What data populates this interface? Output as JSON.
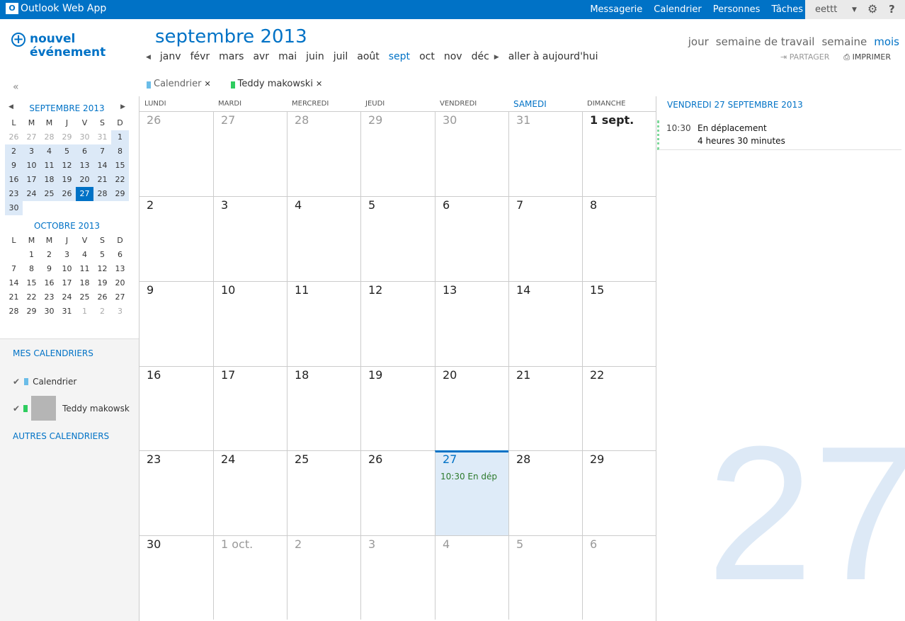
{
  "app": {
    "title": "Outlook Web App",
    "logo_text": "O"
  },
  "nav": [
    "Messagerie",
    "Calendrier",
    "Personnes",
    "Tâches"
  ],
  "user": {
    "name": "eettt",
    "settings_icon": "gear-icon",
    "help_icon": "?"
  },
  "new_event": {
    "line1": "nouvel",
    "line2": "événement"
  },
  "header": {
    "title": "septembre 2013",
    "months": [
      "janv",
      "févr",
      "mars",
      "avr",
      "mai",
      "juin",
      "juil",
      "août",
      "sept",
      "oct",
      "nov",
      "déc"
    ],
    "selected_month": "sept",
    "today": "aller à aujourd'hui"
  },
  "views": [
    "jour",
    "semaine de travail",
    "semaine",
    "mois"
  ],
  "selected_view": "mois",
  "actions": {
    "share": "PARTAGER",
    "print": "IMPRIMER"
  },
  "chips": [
    {
      "label": "Calendrier",
      "color": "#6bbde8"
    },
    {
      "label": "Teddy makowski",
      "color": "#2ecc5f"
    }
  ],
  "collapse": "«",
  "mini": {
    "weekdays": [
      "L",
      "M",
      "M",
      "J",
      "V",
      "S",
      "D"
    ],
    "sept": {
      "title": "SEPTEMBRE 2013",
      "days": [
        "26",
        "27",
        "28",
        "29",
        "30",
        "31",
        "1",
        "2",
        "3",
        "4",
        "5",
        "6",
        "7",
        "8",
        "9",
        "10",
        "11",
        "12",
        "13",
        "14",
        "15",
        "16",
        "17",
        "18",
        "19",
        "20",
        "21",
        "22",
        "23",
        "24",
        "25",
        "26",
        "27",
        "28",
        "29",
        "30"
      ]
    },
    "oct": {
      "title": "OCTOBRE 2013",
      "days": [
        "",
        "1",
        "2",
        "3",
        "4",
        "5",
        "6",
        "7",
        "8",
        "9",
        "10",
        "11",
        "12",
        "13",
        "14",
        "15",
        "16",
        "17",
        "18",
        "19",
        "20",
        "21",
        "22",
        "23",
        "24",
        "25",
        "26",
        "27",
        "28",
        "29",
        "30",
        "31",
        "1",
        "2",
        "3"
      ]
    }
  },
  "my_calendars": {
    "title": "MES CALENDRIERS",
    "items": [
      "Calendrier",
      "Teddy makowsk"
    ],
    "other": "AUTRES CALENDRIERS"
  },
  "weekdays": [
    "LUNDI",
    "MARDI",
    "MERCREDI",
    "JEUDI",
    "VENDREDI",
    "SAMEDI",
    "DIMANCHE"
  ],
  "month_days": [
    "26",
    "27",
    "28",
    "29",
    "30",
    "31",
    "1 sept.",
    "2",
    "3",
    "4",
    "5",
    "6",
    "7",
    "8",
    "9",
    "10",
    "11",
    "12",
    "13",
    "14",
    "15",
    "16",
    "17",
    "18",
    "19",
    "20",
    "21",
    "22",
    "23",
    "24",
    "25",
    "26",
    "27",
    "28",
    "29",
    "30",
    "1 oct.",
    "2",
    "3",
    "4",
    "5",
    "6"
  ],
  "event_cell": "10:30 En dép",
  "detail": {
    "title": "VENDREDI 27 SEPTEMBRE 2013",
    "time": "10:30",
    "subject": "En déplacement",
    "duration": "4 heures 30 minutes",
    "big_day": "27"
  }
}
